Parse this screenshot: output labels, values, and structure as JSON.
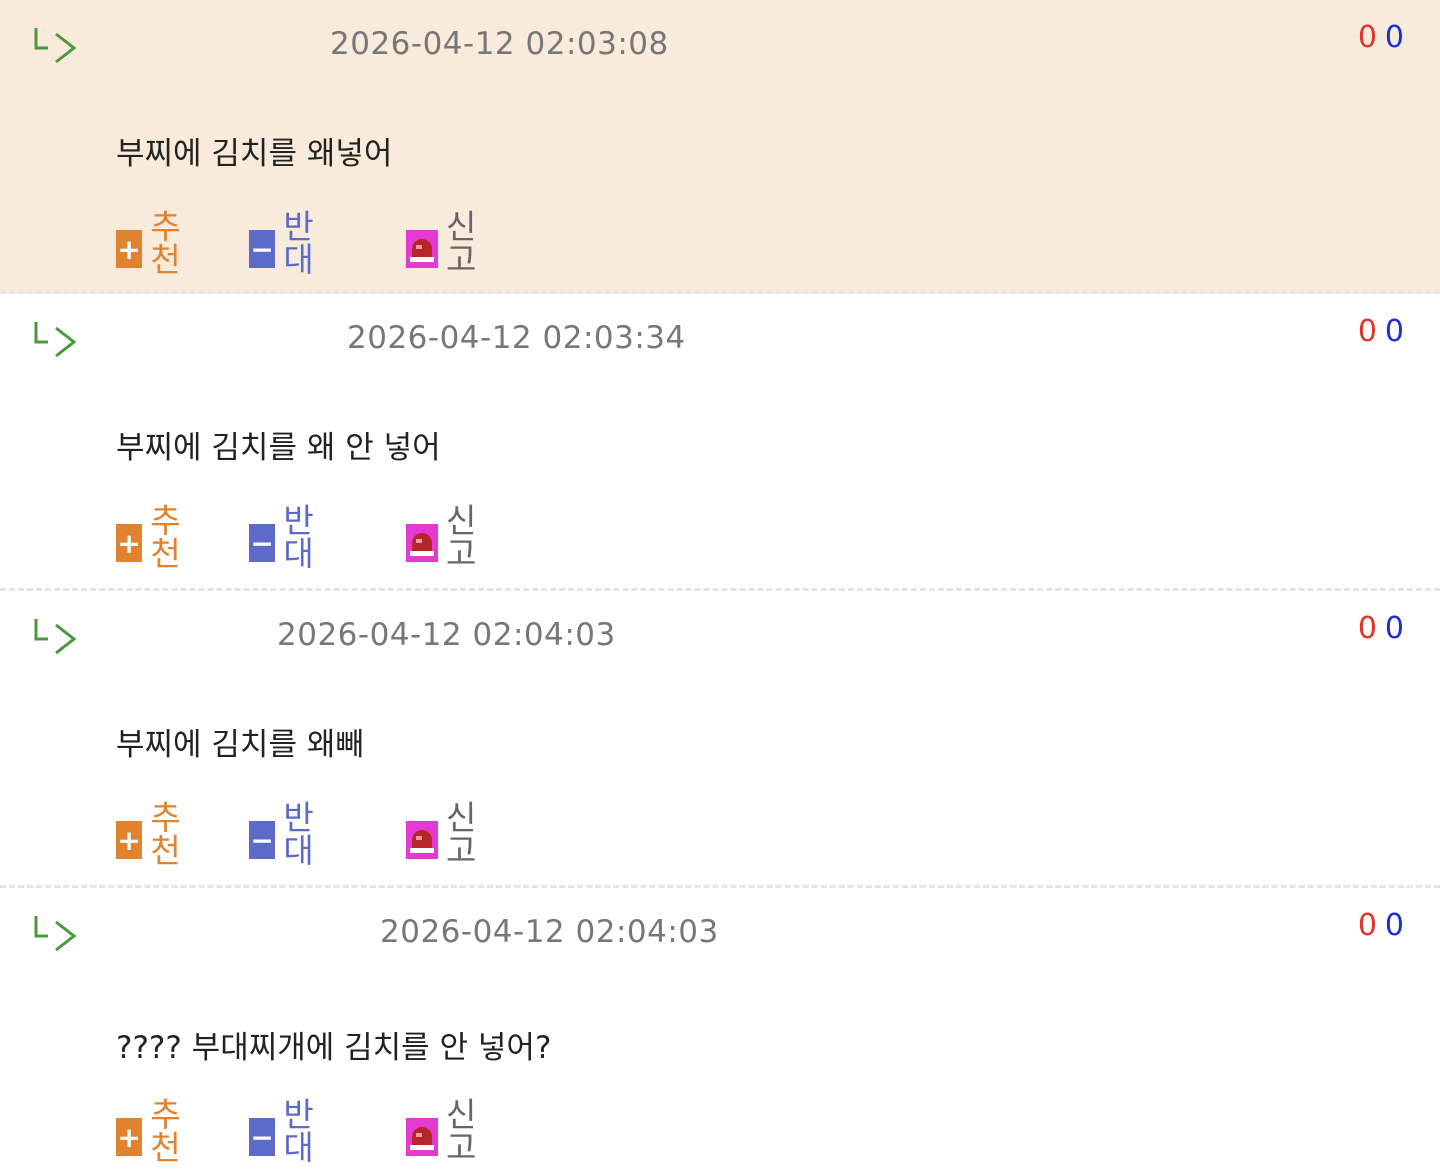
{
  "comments": [
    {
      "timestamp": "2026-04-12 02:03:08",
      "upvotes": "0",
      "downvotes": "0",
      "text": "부찌에 김치를 왜넣어",
      "recommend_label": "추천",
      "oppose_label": "반대",
      "report_label": "신고"
    },
    {
      "timestamp": "2026-04-12 02:03:34",
      "upvotes": "0",
      "downvotes": "0",
      "text": "부찌에 김치를 왜 안 넣어",
      "recommend_label": "추천",
      "oppose_label": "반대",
      "report_label": "신고"
    },
    {
      "timestamp": "2026-04-12 02:04:03",
      "upvotes": "0",
      "downvotes": "0",
      "text": "부찌에 김치를 왜빼",
      "recommend_label": "추천",
      "oppose_label": "반대",
      "report_label": "신고"
    },
    {
      "timestamp": "2026-04-12 02:04:03",
      "upvotes": "0",
      "downvotes": "0",
      "text": "???? 부대찌개에 김치를 안 넣어?",
      "recommend_label": "추천",
      "oppose_label": "반대",
      "report_label": "신고"
    }
  ],
  "colors": {
    "highlight_bg": "#f8ebdc",
    "upvote": "#e0332b",
    "downvote": "#1a2fd6",
    "recommend": "#e0822e",
    "oppose": "#5c6bc7",
    "report_icon": "#e43ad1",
    "reply_icon": "#4a9a3a"
  },
  "icons": {
    "reply": "reply-arrow-icon",
    "recommend": "plus-icon",
    "oppose": "minus-icon",
    "report": "siren-icon"
  }
}
